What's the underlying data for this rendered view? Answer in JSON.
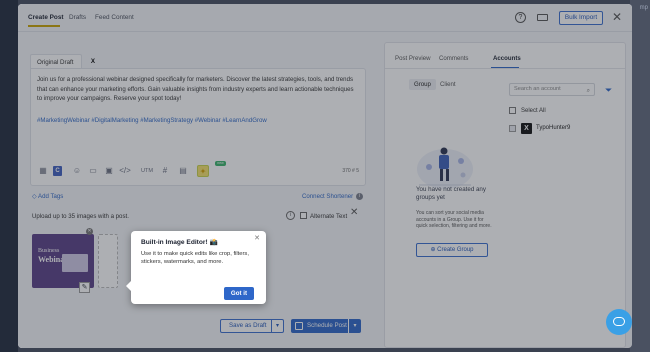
{
  "colors": {
    "accent": "#2e67c9",
    "tab_underline": "#c9a400",
    "link": "#2f68c7"
  },
  "top_right_label": "mp",
  "header": {
    "tabs": [
      "Create Post",
      "Drafts",
      "Feed Content"
    ],
    "bulk_import": "Bulk Import",
    "help_icon": "?",
    "close_icon": "✕"
  },
  "editor": {
    "tab_original": "Original Draft",
    "tab_x": "X",
    "body": "Join us for a professional webinar designed specifically for marketers. Discover the latest strategies, tools, and trends that can enhance your marketing efforts. Gain valuable insights from industry experts and learn actionable techniques to improve your campaigns. Reserve your spot today!",
    "hashtags": "#MarketingWebinar #DigitalMarketing #MarketingStrategy #Webinar #LearnAndGrow",
    "toolbar": {
      "canva": "C",
      "utm": "UTM",
      "ai_badge": "new",
      "char_count": "370",
      "thread_count": "# 5"
    }
  },
  "below_editor": {
    "add_tags": "Add Tags",
    "connect_shortener": "Connect Shortener",
    "info_icon": "i",
    "upload_label": "Upload up to 35 images with a post.",
    "alt_text_label": "Alternate Text",
    "thumb_title_1": "Business",
    "thumb_title_2": "Webinar"
  },
  "footer": {
    "save_as_draft": "Save as Draft",
    "schedule_post": "Schedule Post"
  },
  "right_panel": {
    "tabs": [
      "Post Preview",
      "Comments",
      "Accounts"
    ],
    "group_tab": "Group",
    "client_tab": "Client",
    "search_placeholder": "Search an account",
    "select_all": "Select All",
    "account_name": "TypoHunter9",
    "account_icon": "X",
    "empty_title": "You have not created any groups yet",
    "empty_desc": "You can sort your social media accounts in a Group. Use it for quick selection, filtering and more.",
    "create_group": "Create Group"
  },
  "tooltip": {
    "title": "Built-in Image Editor! 📸",
    "body": "Use it to make quick edits like crop, filters, stickers, watermarks, and more.",
    "button": "Got it"
  }
}
